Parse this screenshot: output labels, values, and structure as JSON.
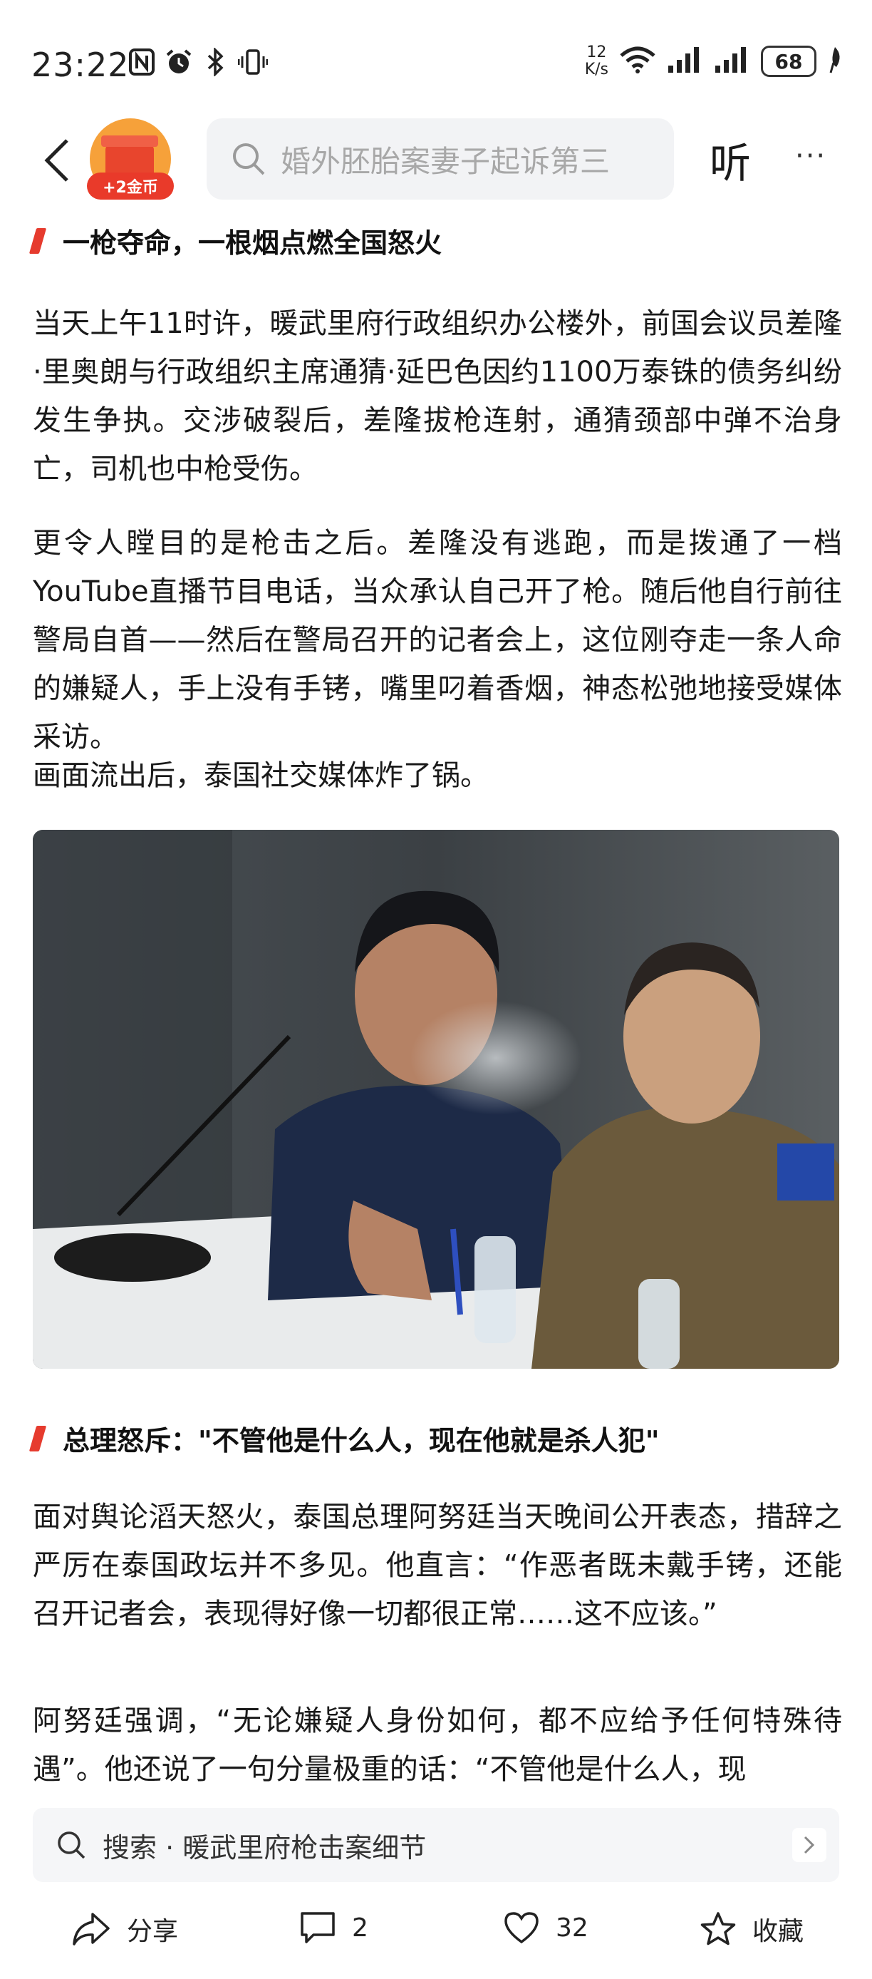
{
  "status_bar": {
    "time": "23:22",
    "net_speed_value": "12",
    "net_speed_unit": "K/s",
    "battery": "68",
    "icons": [
      "nfc-icon",
      "alarm-icon",
      "bluetooth-icon",
      "vibrate-icon",
      "wifi-icon",
      "signal-icon",
      "signal-icon",
      "leaf-icon"
    ]
  },
  "nav": {
    "coin_badge_label": "+2金币",
    "search_placeholder": "婚外胚胎案妻子起诉第三",
    "listen_label": "听",
    "more_label": "···"
  },
  "article": {
    "section1_title": "一枪夺命，一根烟点燃全国怒火",
    "para1": "当天上午11时许，暖武里府行政组织办公楼外，前国会议员差隆·里奥朗与行政组织主席通猜·延巴色因约1100万泰铢的债务纠纷发生争执。交涉破裂后，差隆拔枪连射，通猜颈部中弹不治身亡，司机也中枪受伤。",
    "para2": "更令人瞠目的是枪击之后。差隆没有逃跑，而是拨通了一档YouTube直播节目电话，当众承认自己开了枪。随后他自行前往警局自首——然后在警局召开的记者会上，这位刚夺走一条人命的嫌疑人，手上没有手铐，嘴里叼着香烟，神态松弛地接受媒体采访。",
    "para3": "画面流出后，泰国社交媒体炸了锅。",
    "section2_title": "总理怒斥：\"不管他是什么人，现在他就是杀人犯\"",
    "para4": "面对舆论滔天怒火，泰国总理阿努廷当天晚间公开表态，措辞之严厉在泰国政坛并不多见。他直言：“作恶者既未戴手铐，还能召开记者会，表现得好像一切都很正常……这不应该。”",
    "para5": "阿努廷强调，“无论嫌疑人身份如何，都不应给予任何特殊待遇”。他还说了一句分量极重的话：“不管他是什么人，现"
  },
  "search_suggestion": {
    "prefix": "搜索",
    "separator": "·",
    "query": "暖武里府枪击案细节"
  },
  "bottom_bar": {
    "share_label": "分享",
    "comment_count": "2",
    "like_count": "32",
    "favorite_label": "收藏"
  },
  "colors": {
    "accent_red": "#e63b2e",
    "coin_orange": "#f6a13a",
    "search_bg": "#f2f3f5"
  }
}
